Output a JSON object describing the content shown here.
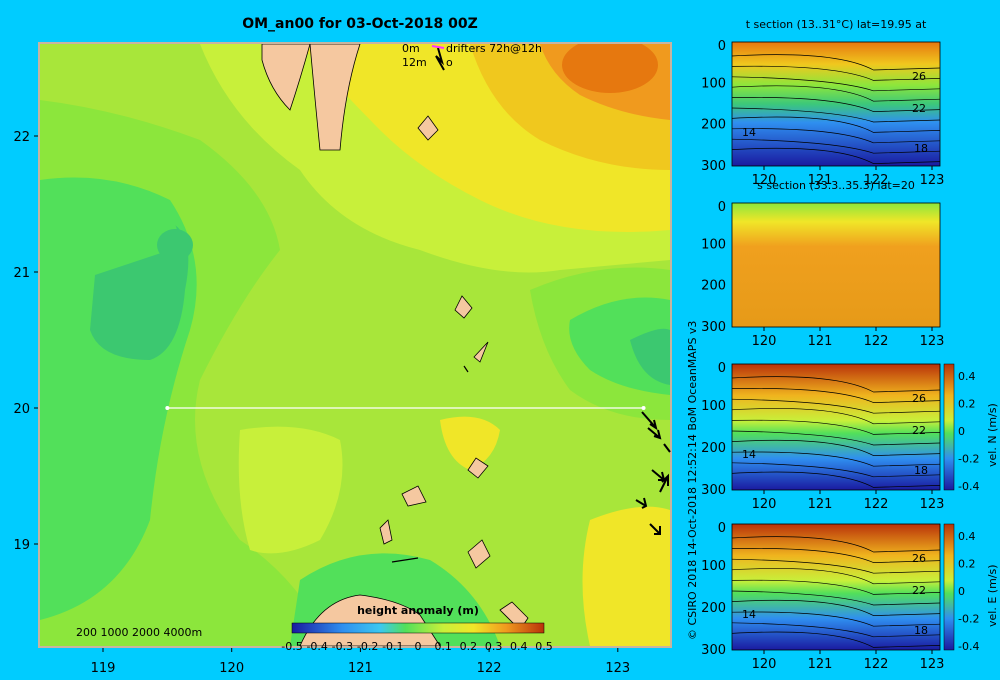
{
  "title": "OM_an00 for 03-Oct-2018 00Z",
  "legend": {
    "level_0": "0m",
    "level_12": "12m",
    "drifters": "drifters 72h@12h"
  },
  "depth_scale": "200  1000  2000  4000m",
  "colorbar": {
    "title": "height anomaly (m)",
    "ticks": [
      "-0.5",
      "-0.4",
      "-0.3",
      "-0.2",
      "-0.1",
      "0",
      "0.1",
      "0.2",
      "0.3",
      "0.4",
      "0.5"
    ],
    "colors": [
      "#1a1aa0",
      "#1f4fd8",
      "#2f8ff0",
      "#3cc8f0",
      "#49e0a8",
      "#52e05a",
      "#8ce63c",
      "#c8f03a",
      "#f0e628",
      "#f0b41e",
      "#e6780f",
      "#b9320a"
    ]
  },
  "map": {
    "x_ticks": [
      "119",
      "120",
      "121",
      "122",
      "123"
    ],
    "y_ticks": [
      "22",
      "21",
      "20",
      "19"
    ],
    "section_line": {
      "lon_start": 119.5,
      "lon_end": 123.2,
      "lat": 20.0
    }
  },
  "credit": "© CSIRO 2018  14-Oct-2018 12:52:14 BoM OceanMAPS v3",
  "panels": [
    {
      "title": "t section (13..31°C) lat=19.95 at",
      "x_ticks": [
        "120",
        "121",
        "122",
        "123"
      ],
      "y_ticks": [
        "0",
        "100",
        "200",
        "300"
      ],
      "contour_labels": [
        "26",
        "22",
        "18",
        "14"
      ],
      "cbar": null
    },
    {
      "title": "s section (33.3..35.3) lat=20",
      "x_ticks": [
        "120",
        "121",
        "122",
        "123"
      ],
      "y_ticks": [
        "0",
        "100",
        "200",
        "300"
      ],
      "contour_labels": [],
      "cbar": null
    },
    {
      "title": "",
      "x_ticks": [
        "120",
        "121",
        "122",
        "123"
      ],
      "y_ticks": [
        "0",
        "100",
        "200",
        "300"
      ],
      "contour_labels": [
        "26",
        "22",
        "18",
        "14"
      ],
      "cbar": {
        "label": "vel. N (m/s)",
        "ticks": [
          "0.4",
          "0.2",
          "0",
          "-0.2",
          "-0.4"
        ]
      }
    },
    {
      "title": "",
      "x_ticks": [
        "120",
        "121",
        "122",
        "123"
      ],
      "y_ticks": [
        "0",
        "100",
        "200",
        "300"
      ],
      "contour_labels": [
        "26",
        "22",
        "18",
        "14"
      ],
      "cbar": {
        "label": "vel. E (m/s)",
        "ticks": [
          "0.4",
          "0.2",
          "0",
          "-0.2",
          "-0.4"
        ]
      }
    }
  ]
}
